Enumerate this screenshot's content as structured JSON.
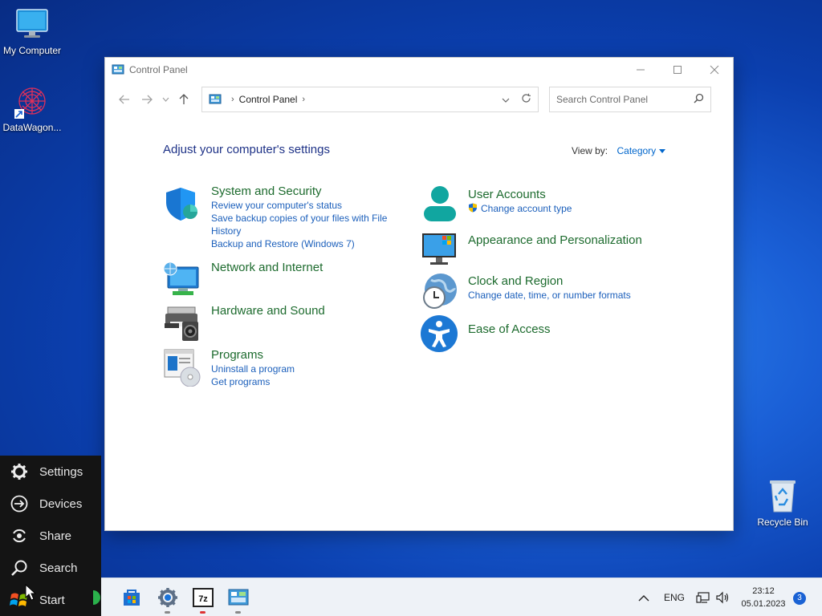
{
  "desktop": {
    "icons": [
      {
        "label": "My Computer"
      },
      {
        "label": "DataWagon..."
      },
      {
        "label": "Recycle Bin"
      }
    ]
  },
  "window": {
    "title": "Control Panel",
    "nav": {
      "breadcrumb": "Control Panel",
      "search_placeholder": "Search Control Panel"
    },
    "heading": "Adjust your computer's settings",
    "view_by_label": "View by:",
    "view_by_value": "Category",
    "categories": [
      {
        "title": "System and Security",
        "links": [
          "Review your computer's status",
          "Save backup copies of your files with File",
          "History",
          "Backup and Restore (Windows 7)"
        ],
        "icon": "shield-icon"
      },
      {
        "title": "Network and Internet",
        "links": [],
        "icon": "network-icon"
      },
      {
        "title": "Hardware and Sound",
        "links": [],
        "icon": "printer-speaker-icon"
      },
      {
        "title": "Programs",
        "links": [
          "Uninstall a program",
          "Get programs"
        ],
        "icon": "programs-icon"
      },
      {
        "title": "User Accounts",
        "links": [
          "Change account type"
        ],
        "icon": "user-icon"
      },
      {
        "title": "Appearance and Personalization",
        "links": [],
        "icon": "monitor-palette-icon"
      },
      {
        "title": "Clock and Region",
        "links": [
          "Change date, time, or number formats"
        ],
        "icon": "globe-clock-icon"
      },
      {
        "title": "Ease of Access",
        "links": [],
        "icon": "accessibility-icon"
      }
    ]
  },
  "start_menu": {
    "items": [
      "Settings",
      "Devices",
      "Share",
      "Search",
      "Start"
    ]
  },
  "taskbar": {
    "tray_lang": "ENG",
    "time": "23:12",
    "date": "05.01.2023",
    "notifications": "3"
  }
}
